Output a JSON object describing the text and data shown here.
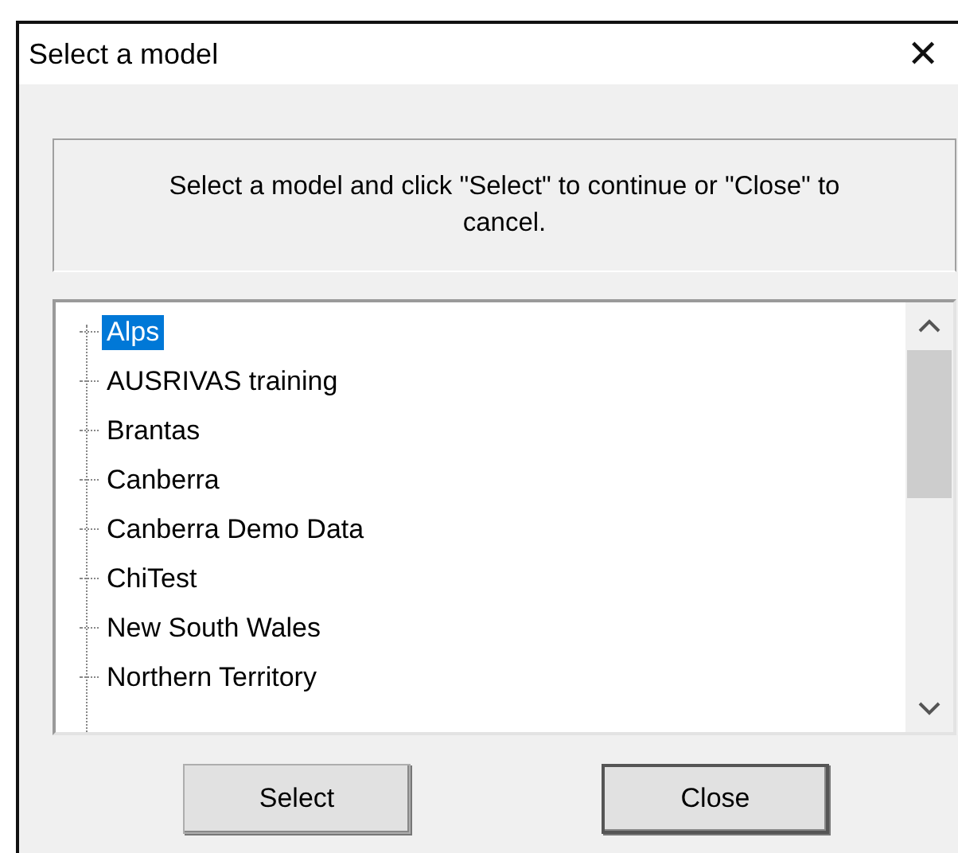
{
  "window": {
    "title": "Select a model",
    "close": "✕"
  },
  "message": "Select a model and click \"Select\" to continue or \"Close\" to cancel.",
  "models": [
    {
      "label": "Alps",
      "selected": true
    },
    {
      "label": "AUSRIVAS training",
      "selected": false
    },
    {
      "label": "Brantas",
      "selected": false
    },
    {
      "label": "Canberra",
      "selected": false
    },
    {
      "label": "Canberra Demo Data",
      "selected": false
    },
    {
      "label": "ChiTest",
      "selected": false
    },
    {
      "label": "New South Wales",
      "selected": false
    },
    {
      "label": "Northern Territory",
      "selected": false
    }
  ],
  "buttons": [
    {
      "label": "Select",
      "default": false
    },
    {
      "label": "Close",
      "default": true
    }
  ]
}
